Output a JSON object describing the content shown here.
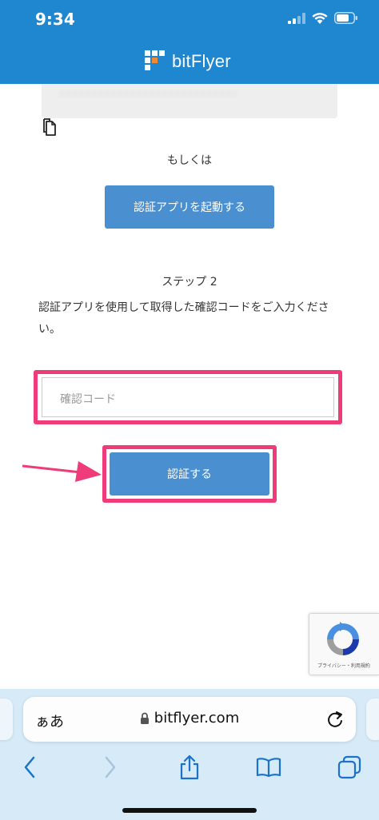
{
  "status_bar": {
    "time": "9:34"
  },
  "header": {
    "logo_text": "bitFlyer"
  },
  "secret": {
    "masked_text": "˙˙˙˙˙˙˙˙˙˙˙˙˙˙˙˙˙˙˙˙˙˙˙˙˙˙˙˙"
  },
  "main": {
    "or_text": "もしくは",
    "launch_app_button": "認証アプリを起動する",
    "step_label": "ステップ 2",
    "instruction": "認証アプリを使用して取得した確認コードをご入力ください。",
    "code_input_placeholder": "確認コード",
    "submit_button": "認証する"
  },
  "recaptcha": {
    "footer_text": "プライバシー・利用規約"
  },
  "browser": {
    "aa_label": "ぁあ",
    "url": "bitflyer.com"
  },
  "colors": {
    "header": "#1f86d0",
    "button": "#4a8fd0",
    "highlight": "#ef3b7a",
    "toolbar": "#d6eaf7",
    "toolbar_icon": "#1a73c8"
  },
  "icons": [
    "signal-icon",
    "wifi-icon",
    "battery-icon",
    "copy-icon",
    "arrow-icon",
    "recaptcha-icon",
    "lock-icon",
    "reload-icon",
    "back-icon",
    "forward-icon",
    "share-icon",
    "bookmarks-icon",
    "tabs-icon"
  ]
}
